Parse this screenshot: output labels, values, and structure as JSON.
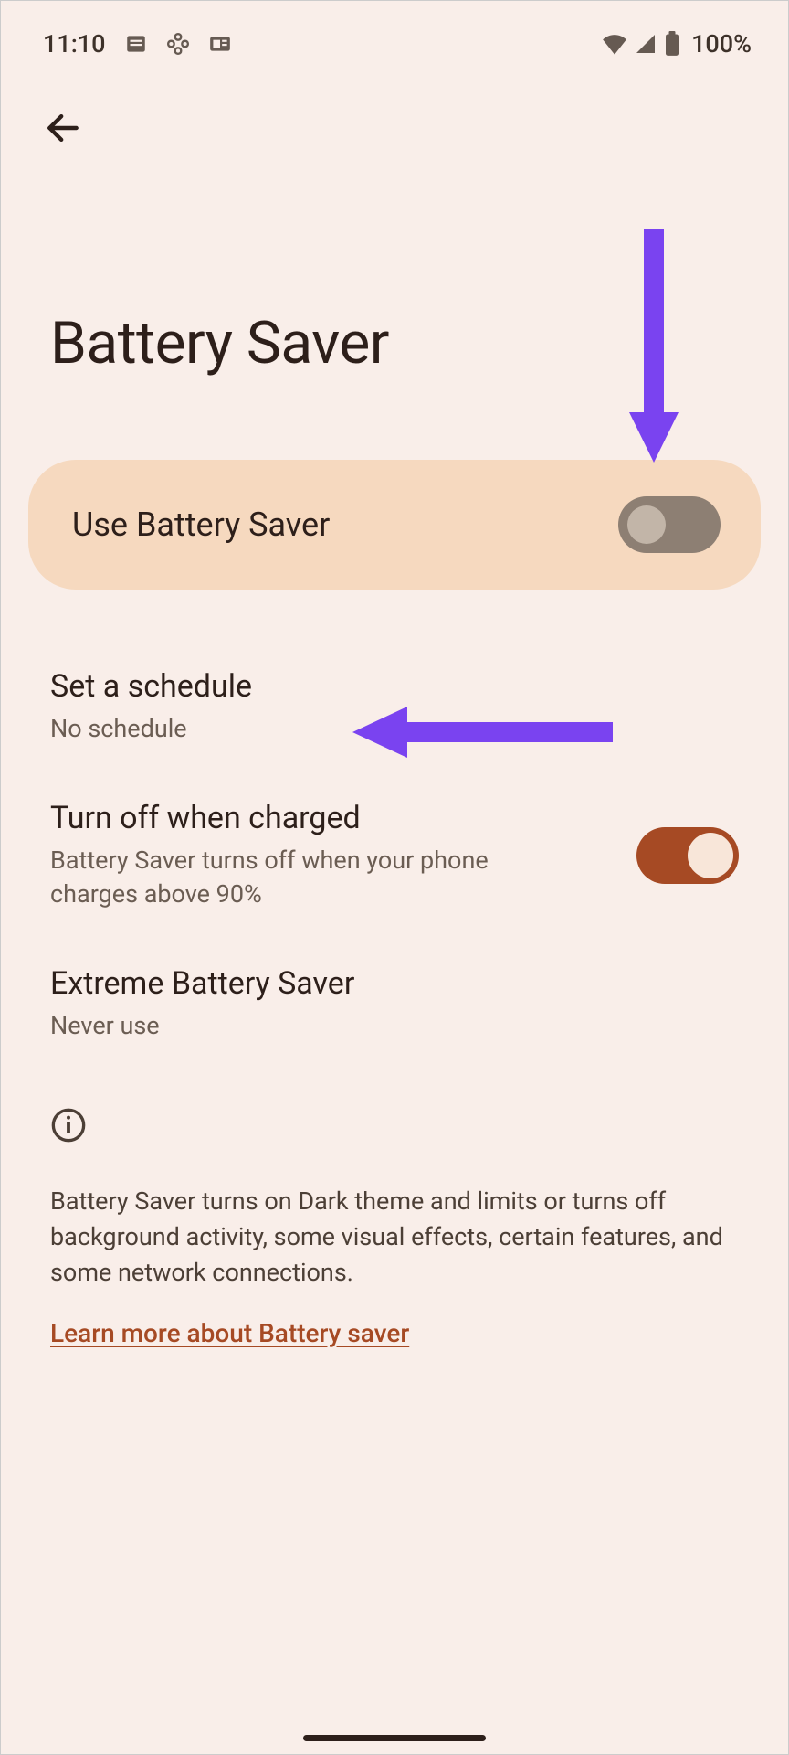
{
  "status": {
    "time": "11:10",
    "battery_text": "100%"
  },
  "page": {
    "title": "Battery Saver"
  },
  "main_toggle": {
    "label": "Use Battery Saver",
    "state": "off"
  },
  "settings": {
    "schedule": {
      "title": "Set a schedule",
      "sub": "No schedule"
    },
    "turn_off_charged": {
      "title": "Turn off when charged",
      "sub": "Battery Saver turns off when your phone charges above 90%",
      "state": "on"
    },
    "extreme": {
      "title": "Extreme Battery Saver",
      "sub": "Never use"
    }
  },
  "info": {
    "text": "Battery Saver turns on Dark theme and limits or turns off background activity, some visual effects, certain features, and some network connections.",
    "link": "Learn more about Battery saver"
  },
  "annotation": {
    "arrow_color": "#7a43f0"
  }
}
